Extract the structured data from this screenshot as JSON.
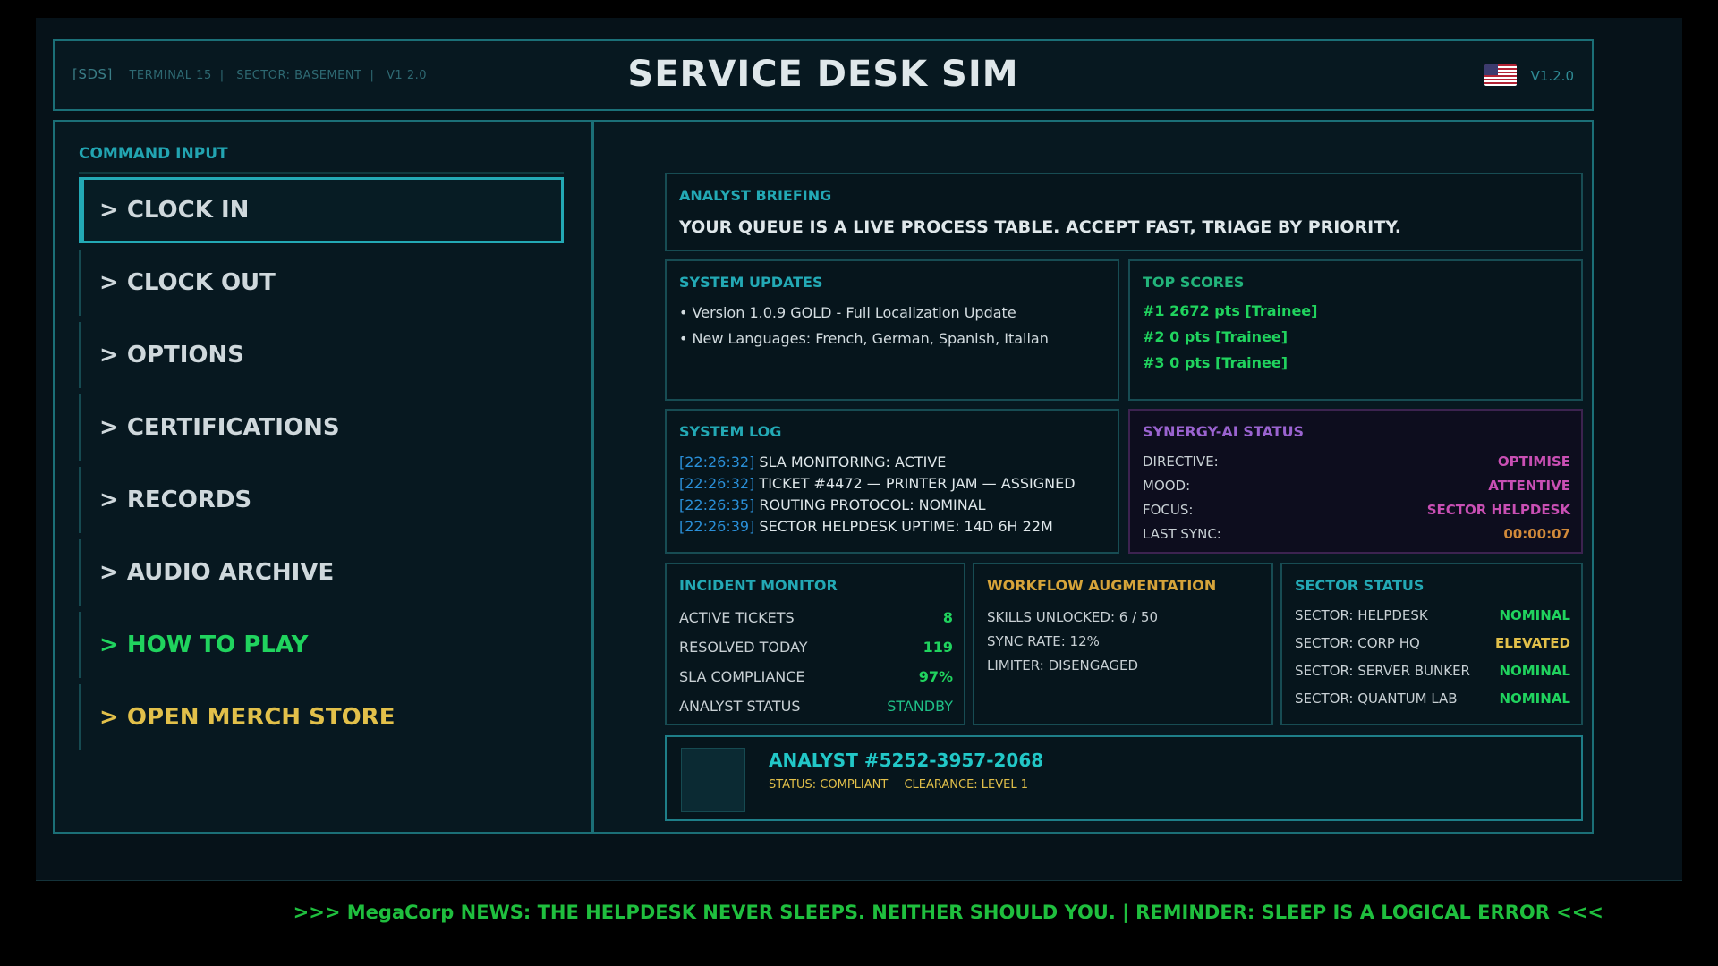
{
  "header": {
    "tag": "[SDS]",
    "meta": [
      "TERMINAL 15",
      "SECTOR: BASEMENT",
      "V1 2.0"
    ],
    "title": "SERVICE DESK SIM",
    "version": "V1.2.0",
    "flag_icon": "us-flag-icon"
  },
  "command": {
    "title": "COMMAND INPUT",
    "items": [
      {
        "label": "> CLOCK IN",
        "active": true
      },
      {
        "label": "> CLOCK OUT"
      },
      {
        "label": "> OPTIONS"
      },
      {
        "label": "> CERTIFICATIONS"
      },
      {
        "label": "> RECORDS"
      },
      {
        "label": "> AUDIO ARCHIVE"
      },
      {
        "label": "> HOW TO PLAY",
        "color": "#20d35e"
      },
      {
        "label": "> OPEN MERCH STORE",
        "color": "#e2c04a"
      }
    ]
  },
  "briefing": {
    "title": "ANALYST BRIEFING",
    "text": "YOUR QUEUE IS A LIVE PROCESS TABLE. ACCEPT FAST, TRIAGE BY PRIORITY."
  },
  "updates": {
    "title": "SYSTEM UPDATES",
    "items": [
      "• Version 1.0.9 GOLD - Full Localization Update",
      "• New Languages: French, German, Spanish, Italian"
    ]
  },
  "scores": {
    "title": "TOP SCORES",
    "rows": [
      "#1  2672 pts  [Trainee]",
      "#2  0 pts  [Trainee]",
      "#3  0 pts  [Trainee]"
    ]
  },
  "syslog": {
    "title": "SYSTEM LOG",
    "rows": [
      {
        "ts": "[22:26:32]",
        "msg": " SLA MONITORING: ACTIVE"
      },
      {
        "ts": "[22:26:32]",
        "msg": " TICKET #4472 — PRINTER JAM — ASSIGNED"
      },
      {
        "ts": "[22:26:35]",
        "msg": " ROUTING PROTOCOL: NOMINAL"
      },
      {
        "ts": "[22:26:39]",
        "msg": " SECTOR HELPDESK UPTIME: 14D 6H 22M"
      }
    ]
  },
  "synergy": {
    "title": "SYNERGY-AI STATUS",
    "rows": [
      {
        "k": "DIRECTIVE:",
        "v": "OPTIMISE"
      },
      {
        "k": "MOOD:",
        "v": "ATTENTIVE"
      },
      {
        "k": "FOCUS:",
        "v": "SECTOR HELPDESK"
      },
      {
        "k": "LAST SYNC:",
        "v": "00:00:07"
      }
    ]
  },
  "incident": {
    "title": "INCIDENT MONITOR",
    "rows": [
      {
        "k": "ACTIVE TICKETS",
        "v": "8"
      },
      {
        "k": "RESOLVED TODAY",
        "v": "119"
      },
      {
        "k": "SLA COMPLIANCE",
        "v": "97%"
      },
      {
        "k": "ANALYST STATUS",
        "v": "STANDBY"
      }
    ]
  },
  "workflow": {
    "title": "WORKFLOW AUGMENTATION",
    "rows": [
      "SKILLS UNLOCKED: 6 / 50",
      "SYNC RATE: 12%",
      "LIMITER: DISENGAGED"
    ]
  },
  "sector": {
    "title": "SECTOR STATUS",
    "rows": [
      {
        "k": "SECTOR: HELPDESK",
        "v": "NOMINAL"
      },
      {
        "k": "SECTOR: CORP HQ",
        "v": "ELEVATED"
      },
      {
        "k": "SECTOR: SERVER BUNKER",
        "v": "NOMINAL"
      },
      {
        "k": "SECTOR: QUANTUM LAB",
        "v": "NOMINAL"
      }
    ]
  },
  "analyst": {
    "id": "ANALYST #5252-3957-2068",
    "status": "STATUS: COMPLIANT",
    "clearance": "CLEARANCE: LEVEL 1"
  },
  "ticker": ">>> MegaCorp NEWS: THE HELPDESK NEVER SLEEPS. NEITHER SHOULD YOU. | REMINDER: SLEEP IS A LOGICAL ERROR <<<"
}
